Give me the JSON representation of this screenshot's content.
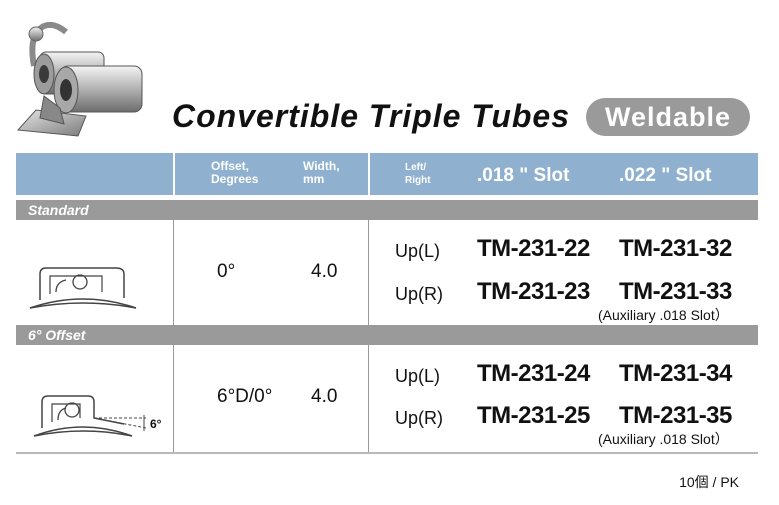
{
  "title": "Convertible Triple Tubes",
  "badge": "Weldable",
  "header": {
    "offset_line1": "Offset,",
    "offset_line2": "Degrees",
    "width_line1": "Width,",
    "width_line2": "mm",
    "side_line1": "Left/",
    "side_line2": "Right",
    "slot018": ".018 \" Slot",
    "slot022": ".022 \" Slot"
  },
  "sections": [
    {
      "name": "Standard",
      "offset": "0°",
      "width": "4.0",
      "rows": [
        {
          "side": "Up(L)",
          "slot018": "TM-231-22",
          "slot022": "TM-231-32"
        },
        {
          "side": "Up(R)",
          "slot018": "TM-231-23",
          "slot022": "TM-231-33"
        }
      ],
      "note": "(Auxiliary .018 Slot）"
    },
    {
      "name": "6° Offset",
      "offset": "6°D/0°",
      "width": "4.0",
      "rows": [
        {
          "side": "Up(L)",
          "slot018": "TM-231-24",
          "slot022": "TM-231-34"
        },
        {
          "side": "Up(R)",
          "slot018": "TM-231-25",
          "slot022": "TM-231-35"
        }
      ],
      "note": "(Auxiliary .018 Slot）",
      "diagram_label": "6°"
    }
  ],
  "footer": "10個 / PK"
}
